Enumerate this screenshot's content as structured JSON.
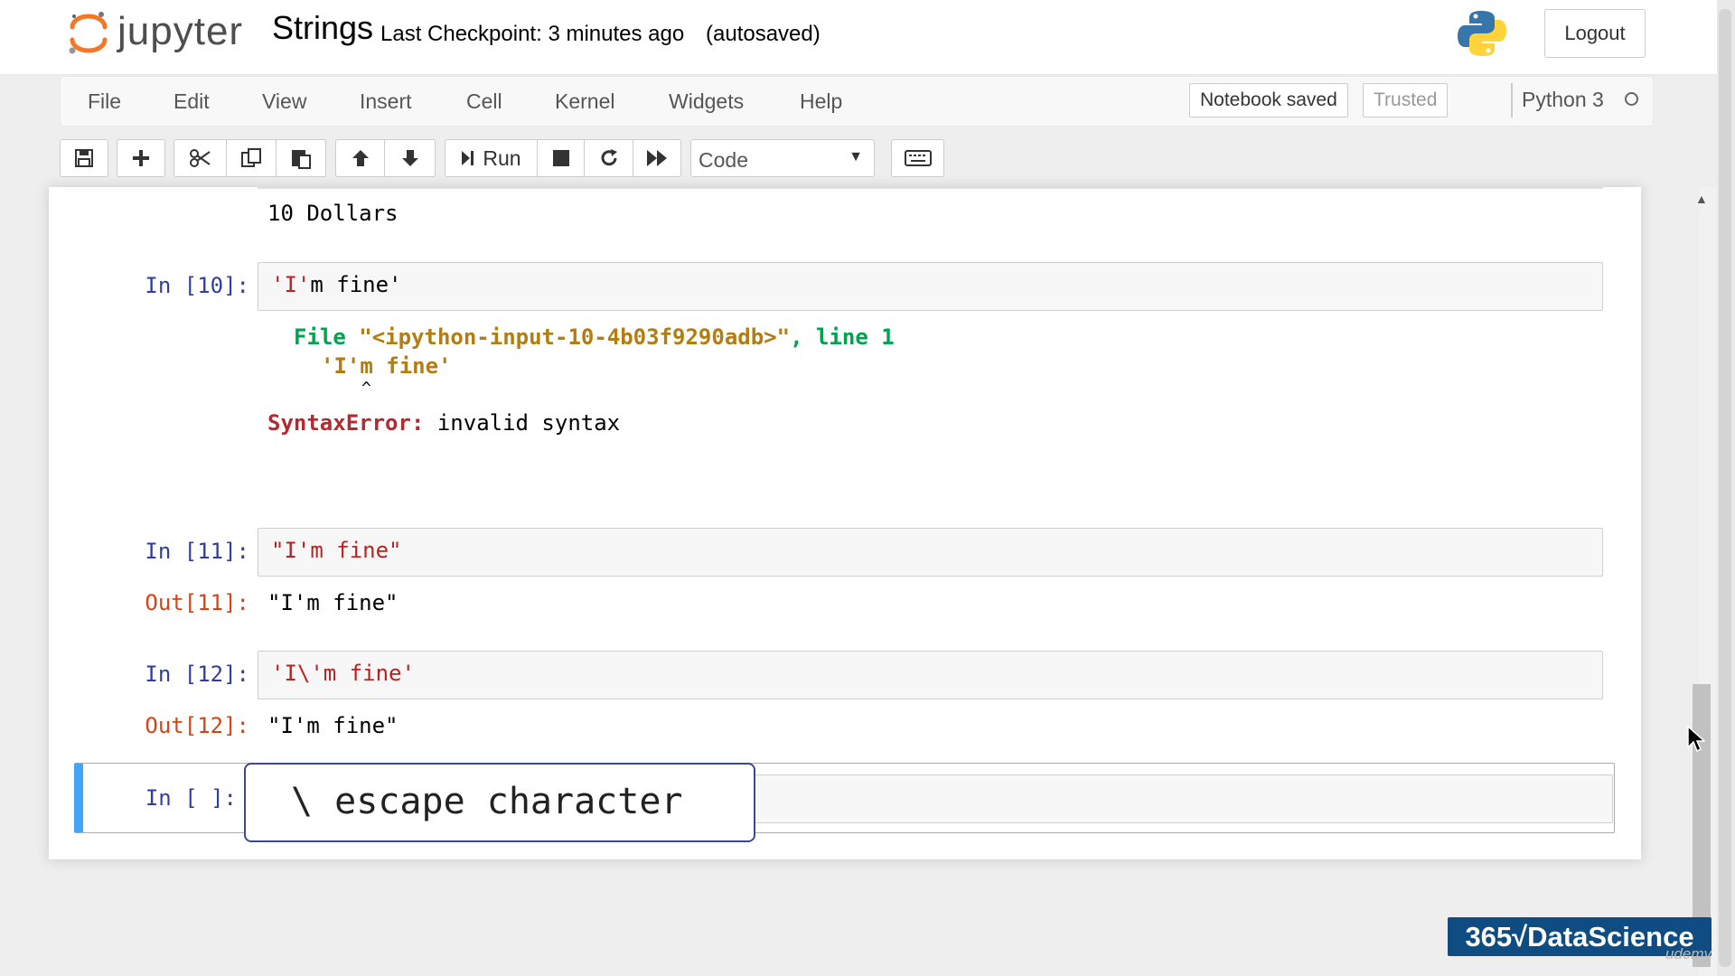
{
  "header": {
    "logo_text": "jupyter",
    "notebook_name": "Strings",
    "checkpoint": "Last Checkpoint: 3 minutes ago",
    "autosave": "(autosaved)",
    "logout_label": "Logout"
  },
  "menubar": {
    "items": [
      "File",
      "Edit",
      "View",
      "Insert",
      "Cell",
      "Kernel",
      "Widgets",
      "Help"
    ],
    "notebook_saved": "Notebook saved",
    "trusted": "Trusted",
    "kernel_name": "Python 3"
  },
  "toolbar": {
    "run_label": "Run",
    "cell_type": "Code",
    "buttons": [
      "save-icon",
      "plus-icon",
      "scissors-icon",
      "copy-icon",
      "paste-icon",
      "arrow-up-icon",
      "arrow-down-icon",
      "run-icon",
      "stop-icon",
      "restart-icon",
      "fast-forward-icon",
      "keyboard-icon"
    ]
  },
  "cells": {
    "prev_output": "10 Dollars",
    "c10": {
      "prompt": "In [10]:",
      "code_q1": "'I'",
      "code_rest": "m fine'",
      "tb_file_prefix": "File ",
      "tb_file_name": "\"<ipython-input-10-4b03f9290adb>\"",
      "tb_line": ", line ",
      "tb_line_no": "1",
      "tb_code": "'I'm fine'",
      "tb_caret": "^",
      "error_name": "SyntaxError:",
      "error_msg": " invalid syntax"
    },
    "c11": {
      "prompt_in": "In [11]:",
      "code": "\"I'm fine\"",
      "prompt_out": "Out[11]:",
      "output": "\"I'm fine\""
    },
    "c12": {
      "prompt_in": "In [12]:",
      "code": "'I\\'m fine'",
      "prompt_out": "Out[12]:",
      "output": "\"I'm fine\""
    },
    "c_empty": {
      "prompt_in": "In [ ]:"
    }
  },
  "overlay": {
    "caption": "\\ escape character",
    "brand": "365√DataScience",
    "watermark": "udemy"
  },
  "colors": {
    "accent": "#42A5F5",
    "prompt_in": "#303f9f",
    "prompt_out": "#d84315",
    "string": "#ba2121",
    "brand_bg": "#0f4c81"
  }
}
